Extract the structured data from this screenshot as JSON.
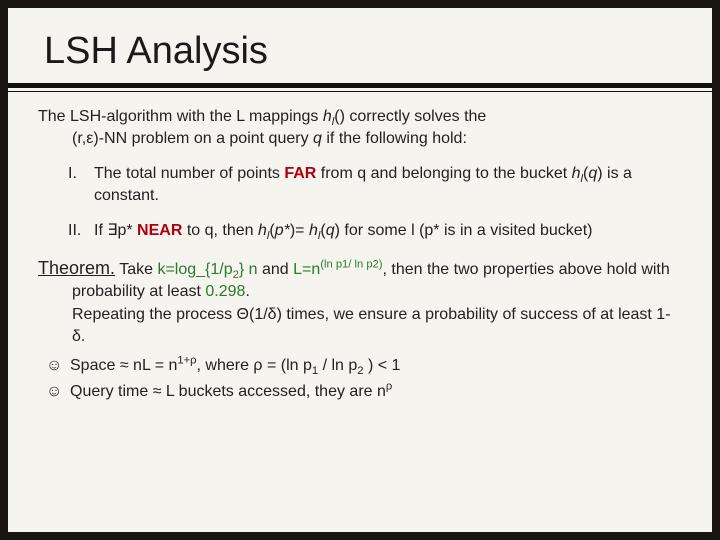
{
  "title": "LSH Analysis",
  "intro": {
    "a": "The LSH-algorithm with the L mappings ",
    "b": "h",
    "c": "l",
    "d": "() correctly solves the",
    "e": "(r,",
    "f": "ε",
    "g": ")-NN problem on a point query ",
    "h": "q",
    "i": " if the following hold:"
  },
  "item1": {
    "num": "I.",
    "a": "The total number of points ",
    "far": "FAR",
    "b": " from q and belonging to the bucket ",
    "c": "h",
    "d": "l",
    "e": "(",
    "f": "q",
    "g": ") is a constant."
  },
  "item2": {
    "num": "II.",
    "a": "If ",
    "ex": "∃",
    "b": "p* ",
    "near": "NEAR",
    "c": " to q, then ",
    "d": "h",
    "e": "l",
    "f": "(",
    "g": "p*",
    "h": ")= ",
    "i": "h",
    "j": "l",
    "k": "(",
    "l": "q",
    "m": ") for some l  (p* is in a visited bucket)"
  },
  "theorem": {
    "head": "Theorem.",
    "a": " Take ",
    "k1": "k=log",
    "k2": "_",
    "k3": "{1/p",
    "k4": "2",
    "k5": "} n",
    "b": " and ",
    "l1": "L=n",
    "l2": "(ln p1/ ln p2)",
    "c": ", then the two properties above hold with probability at least ",
    "prob": "0.298",
    "d": ".",
    "rep1": "Repeating the process ",
    "rep2": "Θ",
    "rep3": "(1/",
    "rep4": "δ",
    "rep5": ") times, we ensure a probability of success of at least 1-",
    "rep6": "δ",
    "rep7": "."
  },
  "space": {
    "face": "☺",
    "a": "Space ≈ nL = n",
    "b": "1+ρ",
    "c": ", where ",
    "d": "ρ",
    "e": " = (ln p",
    "f": "1",
    "g": " / ln p",
    "h": "2",
    "i": " ) < 1"
  },
  "query": {
    "face": "☺",
    "a": "Query time ≈ L buckets accessed, they are n",
    "b": "ρ"
  }
}
